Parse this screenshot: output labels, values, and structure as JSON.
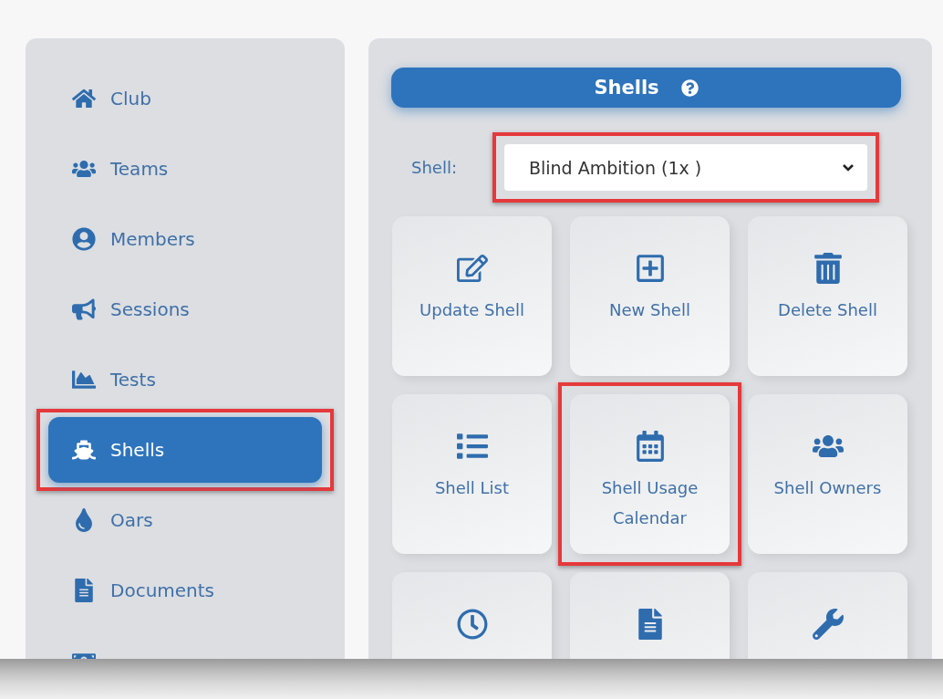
{
  "sidebar": {
    "items": [
      {
        "kind": "home",
        "label": "Club",
        "selected": false,
        "highlighted": false
      },
      {
        "kind": "users",
        "label": "Teams",
        "selected": false,
        "highlighted": false
      },
      {
        "kind": "user-circle",
        "label": "Members",
        "selected": false,
        "highlighted": false
      },
      {
        "kind": "bullhorn",
        "label": "Sessions",
        "selected": false,
        "highlighted": false
      },
      {
        "kind": "area-chart",
        "label": "Tests",
        "selected": false,
        "highlighted": false
      },
      {
        "kind": "ship",
        "label": "Shells",
        "selected": true,
        "highlighted": true
      },
      {
        "kind": "drop",
        "label": "Oars",
        "selected": false,
        "highlighted": false
      },
      {
        "kind": "file",
        "label": "Documents",
        "selected": false,
        "highlighted": false
      },
      {
        "kind": "money",
        "selected": false,
        "highlighted": false
      }
    ]
  },
  "header": {
    "title": "Shells"
  },
  "shell_select": {
    "label": "Shell:",
    "value": "Blind Ambition (1x )",
    "highlighted": true
  },
  "tiles": [
    {
      "kind": "edit",
      "label": "Update Shell",
      "highlighted": false
    },
    {
      "kind": "plus",
      "label": "New Shell",
      "highlighted": false
    },
    {
      "kind": "trash",
      "label": "Delete Shell",
      "highlighted": false
    },
    {
      "kind": "list",
      "label": "Shell List",
      "highlighted": false
    },
    {
      "kind": "calendar",
      "label": "Shell Usage Calendar",
      "highlighted": true
    },
    {
      "kind": "users",
      "label": "Shell Owners",
      "highlighted": false
    },
    {
      "kind": "clock",
      "highlighted": false
    },
    {
      "kind": "file",
      "highlighted": false
    },
    {
      "kind": "wrench",
      "highlighted": false
    }
  ]
}
